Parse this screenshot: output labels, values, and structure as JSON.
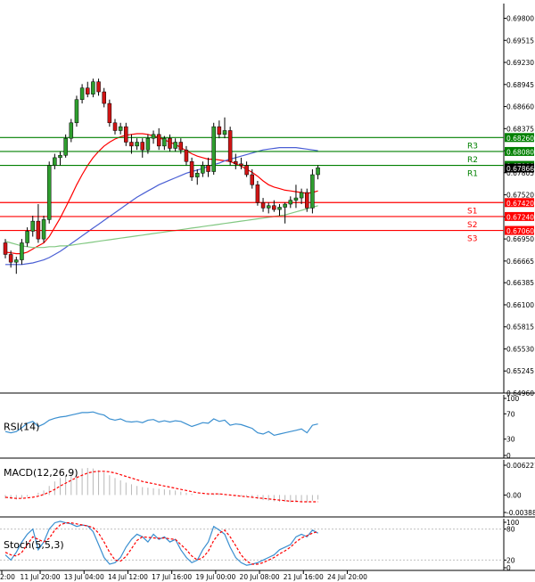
{
  "chart_data": {
    "type": "candlestick",
    "main": {
      "y_ticks": [
        "0.69800",
        "0.69515",
        "0.69230",
        "0.68945",
        "0.68660",
        "0.68375",
        "0.68090",
        "0.67805",
        "0.67520",
        "0.67235",
        "0.66950",
        "0.66665",
        "0.66385",
        "0.66100",
        "0.65815",
        "0.65530",
        "0.65245",
        "0.64960"
      ],
      "ylim": [
        0.6496,
        0.6999
      ],
      "last_price": "0.67866",
      "levels": [
        {
          "label": "R3",
          "value": "0.68260",
          "color": "#008000"
        },
        {
          "label": "R2",
          "value": "0.68080",
          "color": "#008000"
        },
        {
          "label": "R1",
          "value": "0.67900",
          "color": "#008000"
        },
        {
          "label": "S1",
          "value": "0.67420",
          "color": "#ff0000"
        },
        {
          "label": "S2",
          "value": "0.67240",
          "color": "#ff0000"
        },
        {
          "label": "S3",
          "value": "0.67060",
          "color": "#ff0000"
        }
      ],
      "candles": [
        [
          0.669,
          0.6695,
          0.667,
          0.6675
        ],
        [
          0.6675,
          0.668,
          0.6658,
          0.6665
        ],
        [
          0.6665,
          0.6672,
          0.665,
          0.6668
        ],
        [
          0.6668,
          0.6695,
          0.6662,
          0.669
        ],
        [
          0.669,
          0.671,
          0.6685,
          0.6705
        ],
        [
          0.6705,
          0.6725,
          0.6698,
          0.6718
        ],
        [
          0.6718,
          0.674,
          0.669,
          0.6695
        ],
        [
          0.6695,
          0.6725,
          0.669,
          0.672
        ],
        [
          0.672,
          0.6795,
          0.6715,
          0.679
        ],
        [
          0.679,
          0.6805,
          0.6785,
          0.68
        ],
        [
          0.68,
          0.6808,
          0.679,
          0.6803
        ],
        [
          0.6803,
          0.683,
          0.68,
          0.6825
        ],
        [
          0.6825,
          0.685,
          0.682,
          0.6845
        ],
        [
          0.6845,
          0.688,
          0.684,
          0.6875
        ],
        [
          0.6875,
          0.6895,
          0.687,
          0.689
        ],
        [
          0.689,
          0.6898,
          0.6878,
          0.6882
        ],
        [
          0.6882,
          0.6902,
          0.6878,
          0.6898
        ],
        [
          0.6898,
          0.6902,
          0.688,
          0.6885
        ],
        [
          0.6885,
          0.689,
          0.6865,
          0.687
        ],
        [
          0.687,
          0.6875,
          0.684,
          0.6845
        ],
        [
          0.6845,
          0.685,
          0.683,
          0.6835
        ],
        [
          0.6835,
          0.6845,
          0.683,
          0.684
        ],
        [
          0.684,
          0.6845,
          0.6815,
          0.682
        ],
        [
          0.682,
          0.683,
          0.6805,
          0.6815
        ],
        [
          0.6815,
          0.6825,
          0.681,
          0.682
        ],
        [
          0.682,
          0.6825,
          0.68,
          0.681
        ],
        [
          0.681,
          0.683,
          0.6805,
          0.6825
        ],
        [
          0.6825,
          0.6835,
          0.6818,
          0.683
        ],
        [
          0.683,
          0.6838,
          0.681,
          0.6815
        ],
        [
          0.6815,
          0.6828,
          0.681,
          0.6825
        ],
        [
          0.6825,
          0.683,
          0.6808,
          0.6812
        ],
        [
          0.6812,
          0.6825,
          0.6808,
          0.682
        ],
        [
          0.682,
          0.6825,
          0.6805,
          0.681
        ],
        [
          0.681,
          0.6815,
          0.679,
          0.6795
        ],
        [
          0.6795,
          0.68,
          0.677,
          0.6775
        ],
        [
          0.6775,
          0.6785,
          0.6765,
          0.678
        ],
        [
          0.678,
          0.6795,
          0.6775,
          0.679
        ],
        [
          0.679,
          0.68,
          0.6775,
          0.6782
        ],
        [
          0.6782,
          0.6845,
          0.6778,
          0.684
        ],
        [
          0.684,
          0.6848,
          0.6825,
          0.683
        ],
        [
          0.683,
          0.6852,
          0.6825,
          0.6835
        ],
        [
          0.6835,
          0.684,
          0.679,
          0.6795
        ],
        [
          0.6795,
          0.6805,
          0.6785,
          0.6792
        ],
        [
          0.6792,
          0.68,
          0.6785,
          0.679
        ],
        [
          0.679,
          0.6795,
          0.6775,
          0.6778
        ],
        [
          0.6778,
          0.6785,
          0.676,
          0.6765
        ],
        [
          0.6765,
          0.677,
          0.6738,
          0.6742
        ],
        [
          0.6742,
          0.6748,
          0.673,
          0.6735
        ],
        [
          0.6735,
          0.6742,
          0.6728,
          0.6738
        ],
        [
          0.6738,
          0.6745,
          0.673,
          0.6733
        ],
        [
          0.6733,
          0.674,
          0.6725,
          0.6736
        ],
        [
          0.6736,
          0.6742,
          0.6715,
          0.674
        ],
        [
          0.674,
          0.675,
          0.6735,
          0.6745
        ],
        [
          0.6745,
          0.6765,
          0.6735,
          0.6748
        ],
        [
          0.6748,
          0.676,
          0.674,
          0.6755
        ],
        [
          0.6755,
          0.676,
          0.673,
          0.6735
        ],
        [
          0.6735,
          0.6785,
          0.6728,
          0.6778
        ],
        [
          0.6778,
          0.679,
          0.6772,
          0.6787
        ]
      ],
      "overlays": [
        {
          "name": "ma-fast",
          "color": "#ff0000",
          "values": [
            0.6678,
            0.6677,
            0.6676,
            0.6676,
            0.6678,
            0.6682,
            0.6686,
            0.669,
            0.6698,
            0.671,
            0.6722,
            0.6736,
            0.675,
            0.6765,
            0.6778,
            0.679,
            0.68,
            0.6808,
            0.6815,
            0.682,
            0.6824,
            0.6827,
            0.6829,
            0.683,
            0.6831,
            0.6831,
            0.683,
            0.6828,
            0.6826,
            0.6823,
            0.682,
            0.6817,
            0.6813,
            0.6809,
            0.6805,
            0.6802,
            0.68,
            0.6798,
            0.6798,
            0.6797,
            0.6796,
            0.6795,
            0.6792,
            0.6789,
            0.6785,
            0.6781,
            0.6776,
            0.677,
            0.6765,
            0.6762,
            0.676,
            0.6758,
            0.6757,
            0.6756,
            0.6755,
            0.6754,
            0.6755,
            0.6757
          ]
        },
        {
          "name": "ma-mid",
          "color": "#4a5fd4",
          "values": [
            0.6662,
            0.6662,
            0.6662,
            0.6662,
            0.6663,
            0.6664,
            0.6666,
            0.6668,
            0.6671,
            0.6675,
            0.6679,
            0.6684,
            0.6689,
            0.6694,
            0.6699,
            0.6704,
            0.6709,
            0.6714,
            0.6719,
            0.6724,
            0.6729,
            0.6734,
            0.6739,
            0.6744,
            0.6749,
            0.6753,
            0.6757,
            0.6761,
            0.6765,
            0.6768,
            0.6771,
            0.6774,
            0.6777,
            0.678,
            0.6782,
            0.6784,
            0.6786,
            0.6789,
            0.6791,
            0.6793,
            0.6796,
            0.6798,
            0.68,
            0.6802,
            0.6804,
            0.6806,
            0.6808,
            0.681,
            0.6811,
            0.6812,
            0.6813,
            0.6813,
            0.6813,
            0.6813,
            0.6812,
            0.6811,
            0.681,
            0.6809
          ]
        },
        {
          "name": "ma-slow",
          "color": "#82c882",
          "values": [
            0.6692,
            0.669,
            0.6688,
            0.6686,
            0.6685,
            0.6684,
            0.6684,
            0.6684,
            0.6685,
            0.6685,
            0.6686,
            0.6686,
            0.6687,
            0.6688,
            0.6689,
            0.669,
            0.6691,
            0.6692,
            0.6693,
            0.6694,
            0.6695,
            0.6696,
            0.6697,
            0.6698,
            0.6699,
            0.67,
            0.6701,
            0.6702,
            0.6703,
            0.6704,
            0.6705,
            0.6706,
            0.6707,
            0.6708,
            0.6709,
            0.671,
            0.6711,
            0.6712,
            0.6713,
            0.6714,
            0.6715,
            0.6716,
            0.6717,
            0.6718,
            0.6719,
            0.672,
            0.6721,
            0.6722,
            0.6723,
            0.6724,
            0.6725,
            0.6726,
            0.6728,
            0.673,
            0.6732,
            0.6734,
            0.6736,
            0.6738
          ]
        }
      ]
    },
    "x_ticks": [
      {
        "label": "2:00",
        "index": 0
      },
      {
        "label": "11 Jul 20:00",
        "index": 7
      },
      {
        "label": "13 Jul 04:00",
        "index": 15
      },
      {
        "label": "14 Jul 12:00",
        "index": 23
      },
      {
        "label": "17 Jul 16:00",
        "index": 31
      },
      {
        "label": "19 Jul 00:00",
        "index": 39
      },
      {
        "label": "20 Jul 08:00",
        "index": 47
      },
      {
        "label": "21 Jul 16:00",
        "index": 55
      },
      {
        "label": "24 Jul 20:00",
        "index": 63
      }
    ],
    "rsi": {
      "label": "RSI(14)",
      "ylim": [
        0,
        100
      ],
      "ticks": [
        "100",
        "70",
        "30",
        "0"
      ],
      "color": "#3a8fd0",
      "values": [
        42,
        40,
        42,
        48,
        55,
        58,
        50,
        54,
        60,
        63,
        65,
        66,
        68,
        70,
        72,
        72,
        73,
        70,
        68,
        62,
        60,
        62,
        58,
        57,
        58,
        56,
        60,
        61,
        57,
        59,
        57,
        59,
        58,
        54,
        50,
        53,
        56,
        55,
        62,
        58,
        60,
        52,
        54,
        53,
        50,
        47,
        40,
        38,
        42,
        36,
        38,
        40,
        42,
        44,
        46,
        40,
        52,
        54
      ]
    },
    "macd": {
      "label": "MACD(12,26,9)",
      "ylim": [
        -0.003883,
        0.006221
      ],
      "ticks": [
        "0.006221",
        "0.00",
        "-0.003883"
      ],
      "hist_color": "#b8b8b8",
      "signal_color": "#ff0000",
      "histogram": [
        -0.0006,
        -0.0007,
        -0.0008,
        -0.0006,
        -0.0003,
        0.0,
        0.0004,
        0.0008,
        0.0016,
        0.0024,
        0.003,
        0.0035,
        0.004,
        0.0044,
        0.0047,
        0.0048,
        0.0047,
        0.0044,
        0.004,
        0.0035,
        0.003,
        0.0026,
        0.0022,
        0.0019,
        0.0016,
        0.0014,
        0.0013,
        0.0012,
        0.0011,
        0.001,
        0.0009,
        0.0008,
        0.0006,
        0.0004,
        0.0002,
        0.0,
        0.0,
        0.0001,
        0.0003,
        0.0003,
        0.0002,
        0.0,
        -0.0001,
        -0.0002,
        -0.0003,
        -0.0005,
        -0.0007,
        -0.0009,
        -0.001,
        -0.0011,
        -0.0012,
        -0.0012,
        -0.0013,
        -0.0013,
        -0.0012,
        -0.0013,
        -0.001,
        -0.0008
      ],
      "signal": [
        -0.0004,
        -0.0005,
        -0.0006,
        -0.0006,
        -0.0005,
        -0.0004,
        -0.0002,
        0.0001,
        0.0005,
        0.001,
        0.0016,
        0.0021,
        0.0026,
        0.0031,
        0.0035,
        0.0039,
        0.0041,
        0.0042,
        0.0042,
        0.0041,
        0.0039,
        0.0036,
        0.0033,
        0.003,
        0.0027,
        0.0024,
        0.0022,
        0.002,
        0.0018,
        0.0016,
        0.0014,
        0.0012,
        0.001,
        0.0008,
        0.0006,
        0.0004,
        0.0003,
        0.0002,
        0.0002,
        0.0002,
        0.0001,
        0.0,
        -0.0001,
        -0.0002,
        -0.0003,
        -0.0004,
        -0.0005,
        -0.0006,
        -0.0007,
        -0.0008,
        -0.0009,
        -0.001,
        -0.0011,
        -0.0011,
        -0.0012,
        -0.0012,
        -0.0012,
        -0.0012
      ]
    },
    "stoch": {
      "label": "Stoch(5,5,3)",
      "ylim": [
        0,
        100
      ],
      "ticks": [
        "100",
        "80",
        "20",
        "0"
      ],
      "k_color": "#3a8fd0",
      "d_color": "#ff0000",
      "k": [
        30,
        20,
        35,
        55,
        70,
        80,
        40,
        55,
        80,
        92,
        95,
        92,
        90,
        85,
        88,
        86,
        75,
        50,
        25,
        12,
        15,
        25,
        45,
        60,
        70,
        65,
        55,
        70,
        60,
        65,
        55,
        60,
        40,
        25,
        15,
        20,
        40,
        55,
        85,
        78,
        70,
        45,
        25,
        15,
        10,
        12,
        15,
        20,
        25,
        30,
        40,
        45,
        50,
        65,
        70,
        65,
        78,
        72
      ],
      "d": [
        35,
        30,
        28,
        35,
        50,
        65,
        60,
        55,
        62,
        78,
        88,
        92,
        92,
        90,
        88,
        86,
        83,
        72,
        55,
        35,
        20,
        18,
        27,
        42,
        58,
        65,
        64,
        63,
        62,
        63,
        61,
        60,
        50,
        40,
        28,
        20,
        25,
        37,
        58,
        72,
        78,
        65,
        48,
        30,
        18,
        12,
        12,
        15,
        20,
        25,
        32,
        38,
        45,
        55,
        63,
        67,
        72,
        75
      ]
    }
  }
}
